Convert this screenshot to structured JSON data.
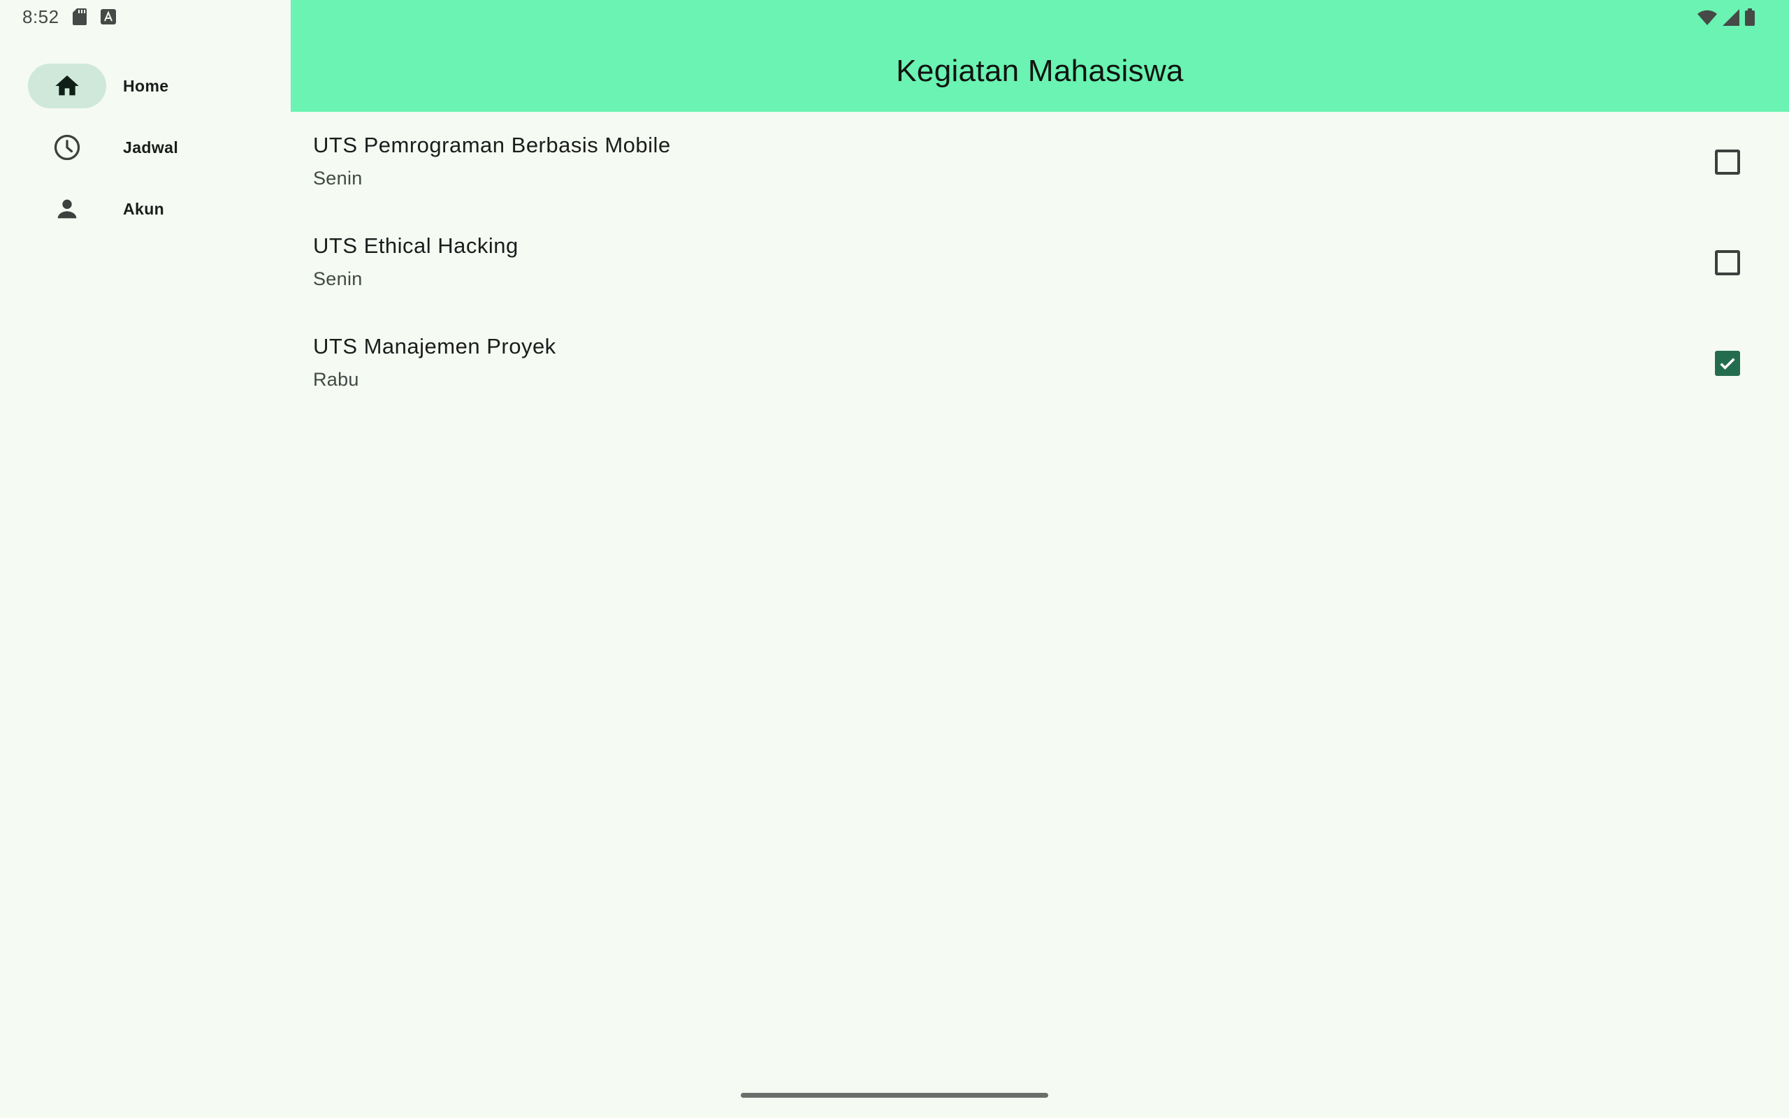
{
  "status_bar": {
    "time": "8:52",
    "left_icons": [
      "sd-card-icon",
      "keyboard-a-icon"
    ],
    "right_icons": [
      "wifi-icon",
      "cell-signal-icon",
      "battery-icon"
    ]
  },
  "nav_rail": {
    "items": [
      {
        "label": "Home",
        "icon": "home-icon",
        "selected": true
      },
      {
        "label": "Jadwal",
        "icon": "clock-icon",
        "selected": false
      },
      {
        "label": "Akun",
        "icon": "person-icon",
        "selected": false
      }
    ]
  },
  "app_bar": {
    "title": "Kegiatan Mahasiswa"
  },
  "activities": [
    {
      "title": "UTS Pemrograman Berbasis Mobile",
      "day": "Senin",
      "checked": false
    },
    {
      "title": "UTS Ethical Hacking",
      "day": "Senin",
      "checked": false
    },
    {
      "title": "UTS Manajemen Proyek",
      "day": "Rabu",
      "checked": true
    }
  ],
  "colors": {
    "app_bar": "#6af3b2",
    "background": "#f5faf3",
    "nav_active_indicator": "#cfe8da",
    "checkbox_checked": "#246c4e"
  }
}
